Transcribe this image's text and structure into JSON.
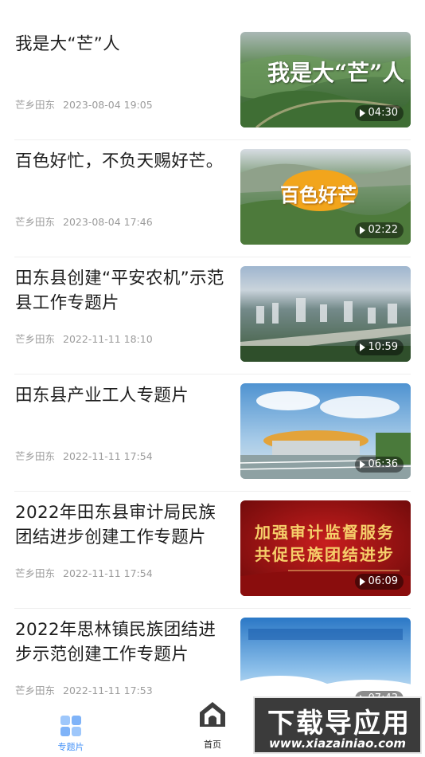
{
  "items": [
    {
      "title": "我是大“芒”人",
      "source": "芒乡田东",
      "date": "2023-08-04 19:05",
      "duration": "04:30",
      "thumb_overlay": "我是大“芒”人"
    },
    {
      "title": "百色好忙，不负天赐好芒。",
      "source": "芒乡田东",
      "date": "2023-08-04 17:46",
      "duration": "02:22",
      "thumb_overlay": "百色好芒"
    },
    {
      "title": "田东县创建“平安农机”示范县工作专题片",
      "source": "芒乡田东",
      "date": "2022-11-11 18:10",
      "duration": "10:59"
    },
    {
      "title": "田东县产业工人专题片",
      "source": "芒乡田东",
      "date": "2022-11-11 17:54",
      "duration": "06:36"
    },
    {
      "title": "2022年田东县审计局民族团结进步创建工作专题片",
      "source": "芒乡田东",
      "date": "2022-11-11 17:54",
      "duration": "06:09",
      "thumb_overlay_line1": "加强审计监督服务",
      "thumb_overlay_line2": "共促民族团结进步"
    },
    {
      "title": "2022年思林镇民族团结进步示范创建工作专题片",
      "source": "芒乡田东",
      "date": "2022-11-11 17:53",
      "duration": "07:43"
    }
  ],
  "nav": {
    "tab_feature": "专题片",
    "tab_home": "首页",
    "active_color": "#3e8ef7"
  },
  "watermark": {
    "big": "下载导应用",
    "small": "www.xiazainiao.com"
  }
}
